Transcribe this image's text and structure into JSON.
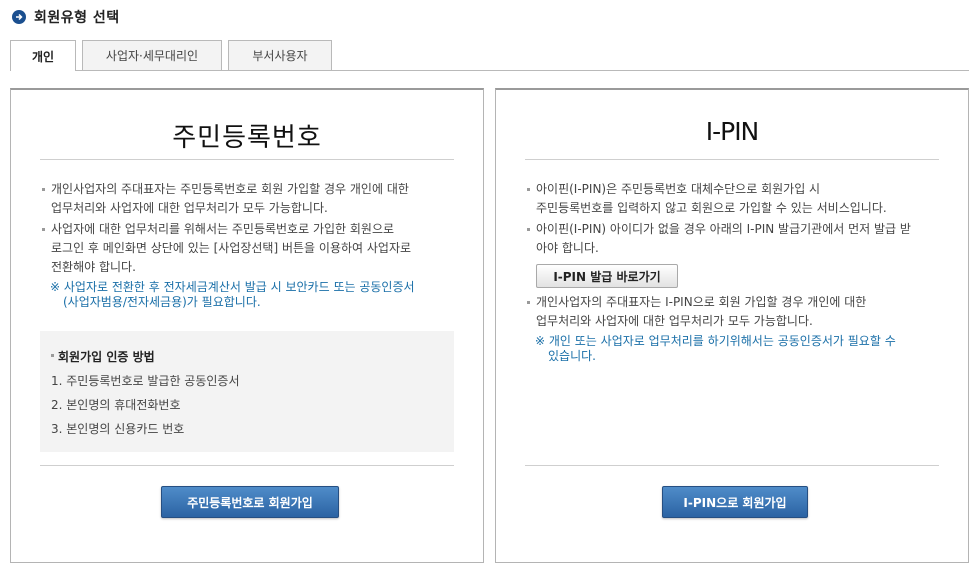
{
  "header": {
    "title": "회원유형 선택",
    "icon": "arrow-right-circle-icon"
  },
  "tabs": [
    {
      "label": "개인",
      "active": true
    },
    {
      "label": "사업자·세무대리인",
      "active": false
    },
    {
      "label": "부서사용자",
      "active": false
    }
  ],
  "left_panel": {
    "heading": "주민등록번호",
    "bullets": [
      {
        "line1": "개인사업자의 주대표자는 주민등록번호로 회원 가입할 경우 개인에 대한",
        "line2": "업무처리와 사업자에 대한 업무처리가 모두 가능합니다."
      },
      {
        "line1": "사업자에 대한 업무처리를 위해서는 주민등록번호로 가입한 회원으로",
        "line2": "로그인 후 메인화면 상단에 있는 [사업장선택] 버튼을 이용하여 사업자로",
        "line3": "전환해야 합니다."
      }
    ],
    "note": {
      "line1": "※ 사업자로 전환한 후 전자세금계산서 발급 시 보안카드 또는 공동인증서",
      "line2": "(사업자범용/전자세금용)가 필요합니다."
    },
    "method": {
      "title": "회원가입 인증 방법",
      "items": [
        "1. 주민등록번호로 발급한 공동인증서",
        "2. 본인명의 휴대전화번호",
        "3. 본인명의 신용카드 번호"
      ]
    },
    "join_button": "주민등록번호로 회원가입"
  },
  "right_panel": {
    "heading": "I-PIN",
    "bullets": [
      {
        "line1": "아이핀(I-PIN)은 주민등록번호 대체수단으로 회원가입 시",
        "line2": "주민등록번호를 입력하지 않고 회원으로 가입할 수 있는 서비스입니다."
      },
      {
        "line1": "아이핀(I-PIN) 아이디가 없을 경우 아래의 I-PIN 발급기관에서 먼저 발급 받",
        "line2": "아야 합니다."
      },
      {
        "line1": "개인사업자의 주대표자는 I-PIN으로 회원 가입할 경우 개인에 대한",
        "line2": "업무처리와 사업자에 대한 업무처리가 모두 가능합니다."
      }
    ],
    "issue_button": "I-PIN 발급 바로가기",
    "note": {
      "line1": "※ 개인 또는 사업자로 업무처리를 하기위해서는 공동인증서가 필요할 수",
      "line2": "있습니다."
    },
    "join_button": "I-PIN으로 회원가입"
  },
  "colors": {
    "accent_blue": "#2b63a3",
    "note_blue": "#1a6fa8",
    "method_box_bg": "#f3f3f3"
  }
}
